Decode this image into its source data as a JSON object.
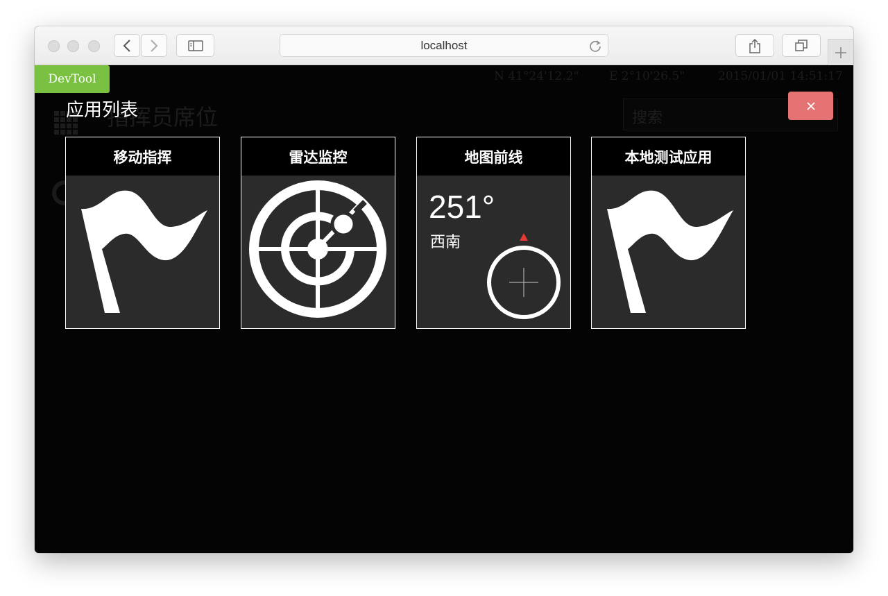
{
  "browser": {
    "address": "localhost"
  },
  "background_app": {
    "coord_n": "N 41°24'12.2\"",
    "coord_e": "E 2°10'26.5\"",
    "datetime": "2015/01/01 14:51:17",
    "title": "指挥员席位",
    "search_placeholder": "搜索"
  },
  "devtool": {
    "label": "DevTool"
  },
  "overlay": {
    "title": "应用列表",
    "close_icon": "close-icon",
    "apps": [
      {
        "label": "移动指挥",
        "icon": "flag-icon"
      },
      {
        "label": "雷达监控",
        "icon": "radar-icon"
      },
      {
        "label": "地图前线",
        "icon": "compass-icon",
        "heading": "251°",
        "direction": "西南"
      },
      {
        "label": "本地测试应用",
        "icon": "flag-icon"
      }
    ]
  },
  "colors": {
    "devtool_green": "#7ac142",
    "close_red": "#e57373",
    "compass_marker": "#e53935"
  }
}
